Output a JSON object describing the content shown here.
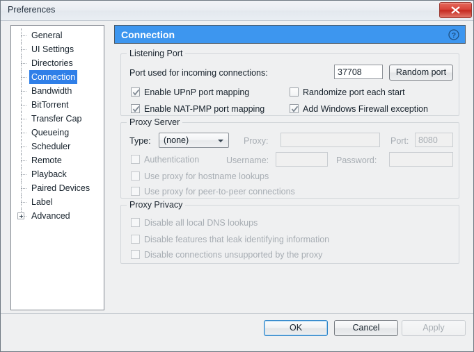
{
  "window": {
    "title": "Preferences",
    "close_label": "x",
    "close_icon": "close-icon",
    "accent_color": "#3d96ef",
    "close_color": "#c5291f"
  },
  "sidebar": {
    "items": [
      {
        "label": "General",
        "selected": false,
        "expandable": false
      },
      {
        "label": "UI Settings",
        "selected": false,
        "expandable": false
      },
      {
        "label": "Directories",
        "selected": false,
        "expandable": false
      },
      {
        "label": "Connection",
        "selected": true,
        "expandable": false
      },
      {
        "label": "Bandwidth",
        "selected": false,
        "expandable": false
      },
      {
        "label": "BitTorrent",
        "selected": false,
        "expandable": false
      },
      {
        "label": "Transfer Cap",
        "selected": false,
        "expandable": false
      },
      {
        "label": "Queueing",
        "selected": false,
        "expandable": false
      },
      {
        "label": "Scheduler",
        "selected": false,
        "expandable": false
      },
      {
        "label": "Remote",
        "selected": false,
        "expandable": false
      },
      {
        "label": "Playback",
        "selected": false,
        "expandable": false
      },
      {
        "label": "Paired Devices",
        "selected": false,
        "expandable": false
      },
      {
        "label": "Label",
        "selected": false,
        "expandable": false
      },
      {
        "label": "Advanced",
        "selected": false,
        "expandable": true
      }
    ]
  },
  "panel": {
    "title": "Connection",
    "help_icon": "help-icon",
    "listening_port": {
      "legend": "Listening Port",
      "port_label": "Port used for incoming connections:",
      "port_value": "37708",
      "random_port_label": "Random port",
      "checkboxes": [
        {
          "label": "Enable UPnP port mapping",
          "checked": true,
          "enabled": true
        },
        {
          "label": "Randomize port each start",
          "checked": false,
          "enabled": true
        },
        {
          "label": "Enable NAT-PMP port mapping",
          "checked": true,
          "enabled": true
        },
        {
          "label": "Add Windows Firewall exception",
          "checked": true,
          "enabled": true
        }
      ]
    },
    "proxy_server": {
      "legend": "Proxy Server",
      "type_label": "Type:",
      "type_value": "(none)",
      "proxy_label": "Proxy:",
      "proxy_value": "",
      "port_label": "Port:",
      "port_value": "8080",
      "auth_label": "Authentication",
      "auth_checked": false,
      "username_label": "Username:",
      "username_value": "",
      "password_label": "Password:",
      "password_value": "",
      "checkboxes": [
        {
          "label": "Use proxy for hostname lookups",
          "checked": false
        },
        {
          "label": "Use proxy for peer-to-peer connections",
          "checked": false
        }
      ]
    },
    "proxy_privacy": {
      "legend": "Proxy Privacy",
      "checkboxes": [
        {
          "label": "Disable all local DNS lookups",
          "checked": false
        },
        {
          "label": "Disable features that leak identifying information",
          "checked": false
        },
        {
          "label": "Disable connections unsupported by the proxy",
          "checked": false
        }
      ]
    }
  },
  "footer": {
    "ok_label": "OK",
    "cancel_label": "Cancel",
    "apply_label": "Apply",
    "apply_enabled": false
  }
}
